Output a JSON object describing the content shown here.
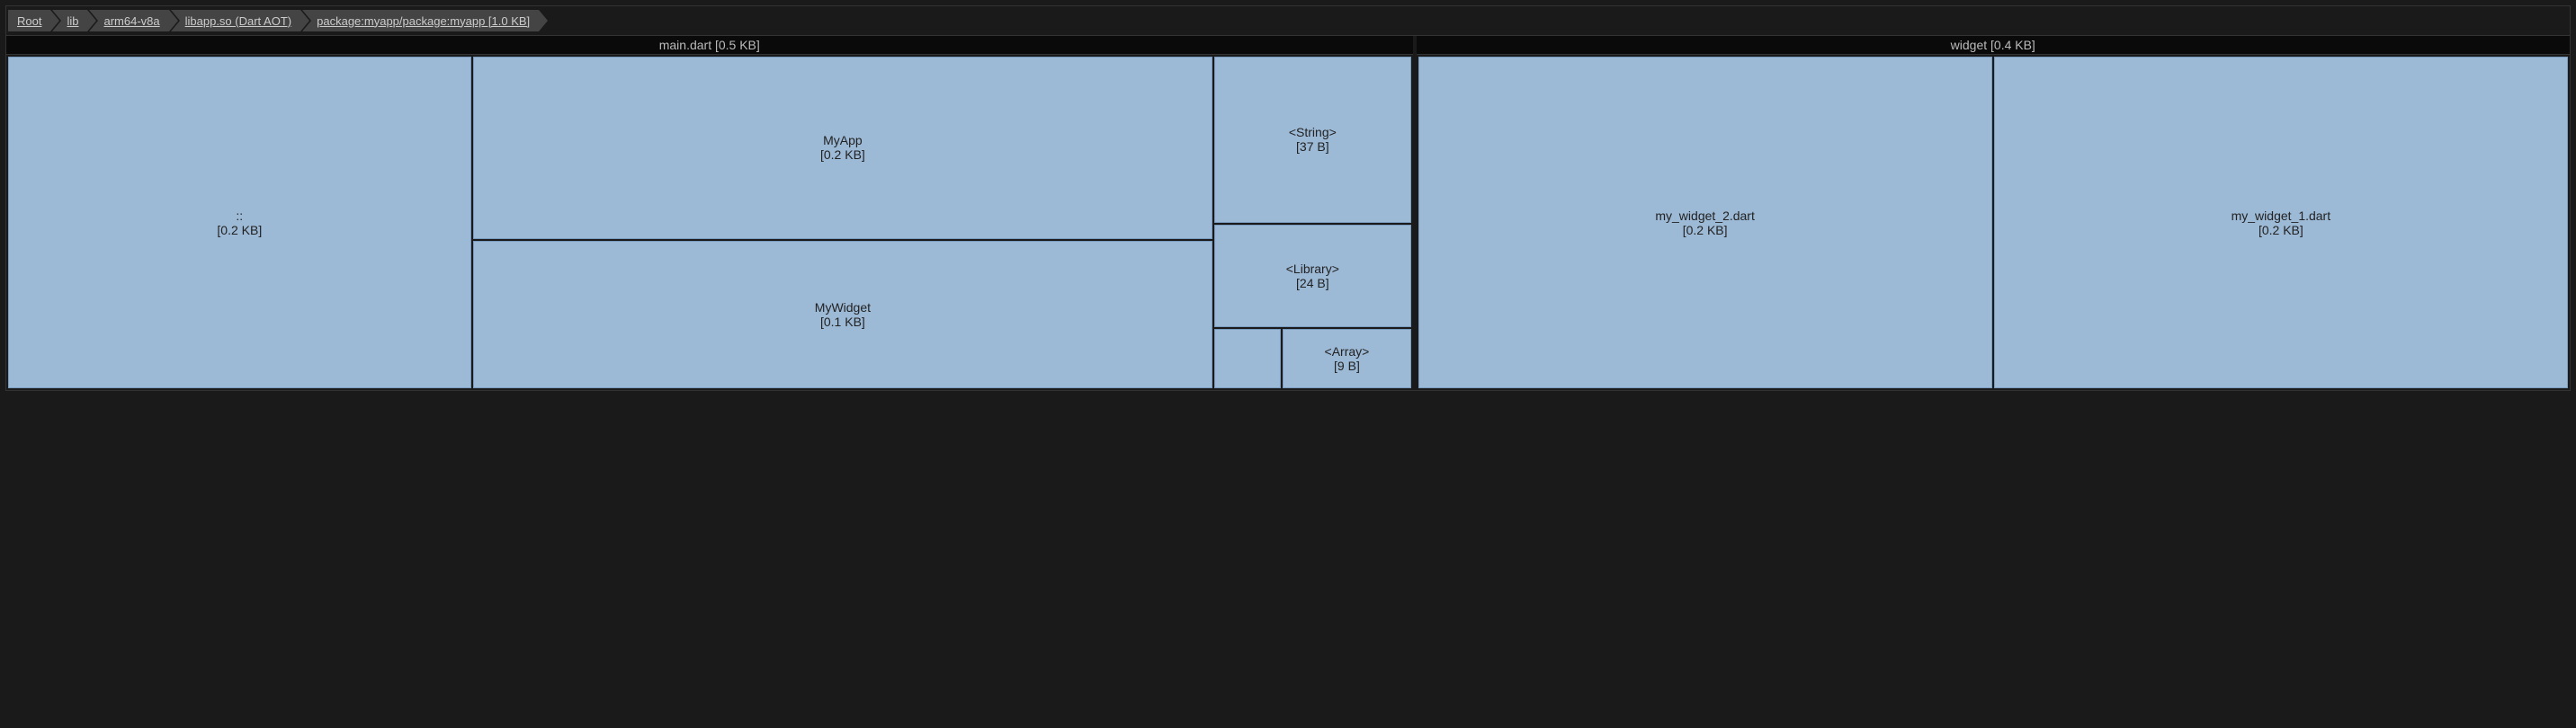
{
  "breadcrumb": [
    {
      "label": "Root",
      "underlined": true
    },
    {
      "label": "lib",
      "underlined": true
    },
    {
      "label": "arm64-v8a",
      "underlined": true
    },
    {
      "label": "libapp.so (Dart AOT)",
      "underlined": true
    },
    {
      "label": "package:myapp/package:myapp [1.0 KB]",
      "underlined": true
    }
  ],
  "left": {
    "header": "main.dart [0.5 KB]",
    "cells": {
      "anon": {
        "label": "::",
        "size": "[0.2 KB]"
      },
      "myapp": {
        "label": "MyApp",
        "size": "[0.2 KB]"
      },
      "mywidget": {
        "label": "MyWidget",
        "size": "[0.1 KB]"
      },
      "string": {
        "label": "<String>",
        "size": "[37 B]"
      },
      "library": {
        "label": "<Library>",
        "size": "[24 B]"
      },
      "array": {
        "label": "<Array>",
        "size": "[9 B]"
      }
    }
  },
  "right": {
    "header": "widget [0.4 KB]",
    "cells": {
      "w2": {
        "label": "my_widget_2.dart",
        "size": "[0.2 KB]"
      },
      "w1": {
        "label": "my_widget_1.dart",
        "size": "[0.2 KB]"
      }
    }
  }
}
